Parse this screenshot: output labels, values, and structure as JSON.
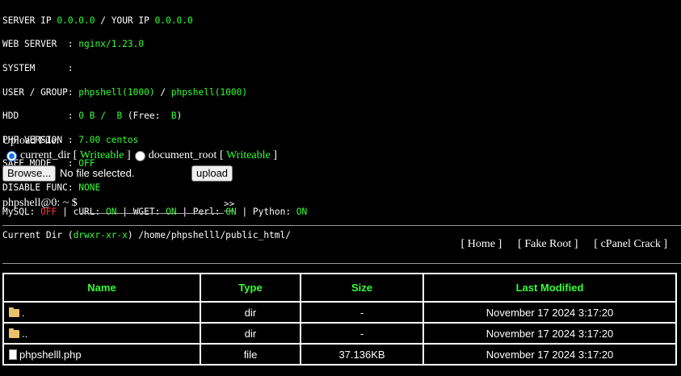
{
  "server": {
    "server_ip_label": "SERVER IP ",
    "server_ip": "0.0.0.0",
    "your_ip_label": " / YOUR IP ",
    "your_ip": "0.0.0.0",
    "web_server_label": "WEB SERVER  : ",
    "web_server": "nginx/1.23.0",
    "system_label": "SYSTEM      :",
    "user_group_label": "USER / GROUP: ",
    "user": "phpshell(1000)",
    "user_sep": " / ",
    "group": "phpshell(1000)",
    "hdd_label": "HDD         : ",
    "hdd_value": "0 B /  B",
    "hdd_free_label": " (Free:  ",
    "hdd_free_value": "B",
    "hdd_free_close": ")",
    "php_version_label": "PHP VERSION : ",
    "php_version": "7.00 centos",
    "safe_mode_label": "SAFE MODE   : ",
    "safe_mode": "OFF",
    "disable_func_label": "DISABLE FUNC: ",
    "disable_func": "NONE",
    "mysql_label": "MySQL: ",
    "mysql": "OFF",
    "curl_label": " | cURL: ",
    "curl": "ON",
    "wget_label": " | WGET: ",
    "wget": "ON",
    "perl_label": " | Perl: ",
    "perl": "ON",
    "python_label": " | Python: ",
    "python": "ON",
    "current_dir_label": "Current Dir (",
    "current_dir_perm": "drwxr-xr-x",
    "current_dir_close": ") ",
    "current_dir_path": "/home/phpshelll/public_html/"
  },
  "upload": {
    "title": "Upload File:",
    "option1": "current_dir",
    "option1_status": "Writeable",
    "option2": "document_root",
    "option2_status": "Writeable",
    "browse_label": "Browse...",
    "no_file": "No file selected.",
    "upload_label": "upload"
  },
  "terminal": {
    "prompt": "phpshell@0: ~ $",
    "command": "",
    "go_label": ">>"
  },
  "nav": {
    "home": "[ Home ]",
    "fake_root": "[ Fake Root ]",
    "cpanel_crack": "[ cPanel Crack ]"
  },
  "table": {
    "headers": [
      "Name",
      "Type",
      "Size",
      "Last Modified"
    ],
    "rows": [
      {
        "name": ".",
        "icon": "folder-icon",
        "type": "dir",
        "size": "-",
        "modified": "November 17 2024 3:17:20"
      },
      {
        "name": "..",
        "icon": "folder-icon",
        "type": "dir",
        "size": "-",
        "modified": "November 17 2024 3:17:20"
      },
      {
        "name": "phpshelll.php",
        "icon": "file-icon",
        "type": "file",
        "size": "37.136KB",
        "modified": "November 17 2024 3:17:20"
      }
    ]
  },
  "colors": {
    "background": "#000000",
    "accent_green": "#33ff33",
    "off_red": "#ff3333"
  }
}
